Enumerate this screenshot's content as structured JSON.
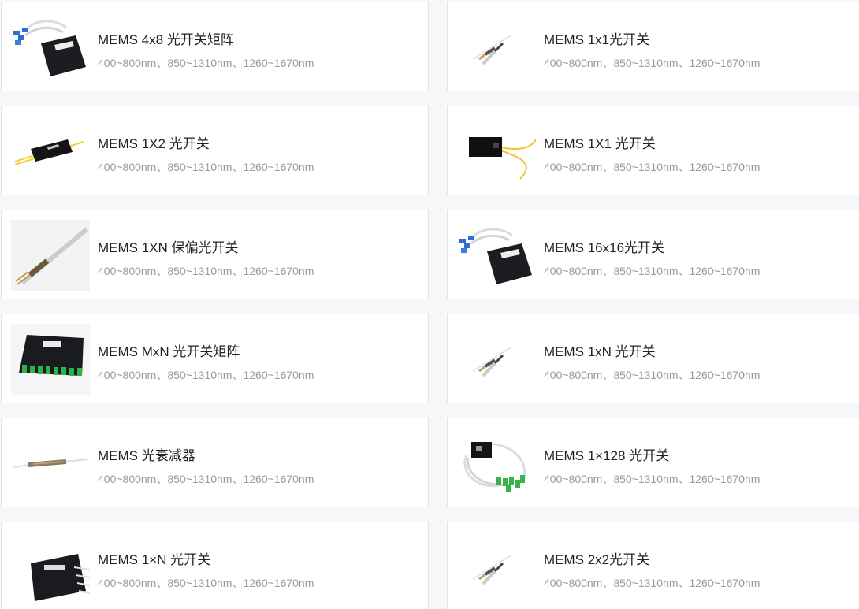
{
  "products": [
    {
      "title": "MEMS 4x8 光开关矩阵",
      "range": "400~800nm、850~1310nm、1260~1670nm",
      "icon": "fiber-box-blue-connectors-icon"
    },
    {
      "title": "MEMS 1x1光开关",
      "range": "400~800nm、850~1310nm、1260~1670nm",
      "icon": "fiber-pigtail-icon"
    },
    {
      "title": "MEMS 1X2 光开关",
      "range": "400~800nm、850~1310nm、1260~1670nm",
      "icon": "black-module-yellow-fiber-icon"
    },
    {
      "title": "MEMS 1X1 光开关",
      "range": "400~800nm、850~1310nm、1260~1670nm",
      "icon": "black-box-yellow-fiber-icon"
    },
    {
      "title": "MEMS 1XN 保偏光开关",
      "range": "400~800nm、850~1310nm、1260~1670nm",
      "icon": "pm-fiber-tube-icon"
    },
    {
      "title": "MEMS 16x16光开关",
      "range": "400~800nm、850~1310nm、1260~1670nm",
      "icon": "fiber-box-blue-connectors-icon"
    },
    {
      "title": "MEMS MxN 光开关矩阵",
      "range": "400~800nm、850~1310nm、1260~1670nm",
      "icon": "rack-module-green-ports-icon"
    },
    {
      "title": "MEMS 1xN 光开关",
      "range": "400~800nm、850~1310nm、1260~1670nm",
      "icon": "fiber-pigtail-icon"
    },
    {
      "title": "MEMS 光衰减器",
      "range": "400~800nm、850~1310nm、1260~1670nm",
      "icon": "attenuator-tube-icon"
    },
    {
      "title": "MEMS 1×128 光开关",
      "range": "400~800nm、850~1310nm、1260~1670nm",
      "icon": "fiber-bundle-green-connectors-icon"
    },
    {
      "title": "MEMS 1×N 光开关",
      "range": "400~800nm、850~1310nm、1260~1670nm",
      "icon": "black-box-fiber-fan-icon"
    },
    {
      "title": "MEMS 2x2光开关",
      "range": "400~800nm、850~1310nm、1260~1670nm",
      "icon": "fiber-pigtail-icon"
    }
  ],
  "colors": {
    "page_bg": "#f6f7f9",
    "card_border": "#e2e3e6",
    "title": "#222222",
    "subtitle": "#9a9a9a"
  }
}
